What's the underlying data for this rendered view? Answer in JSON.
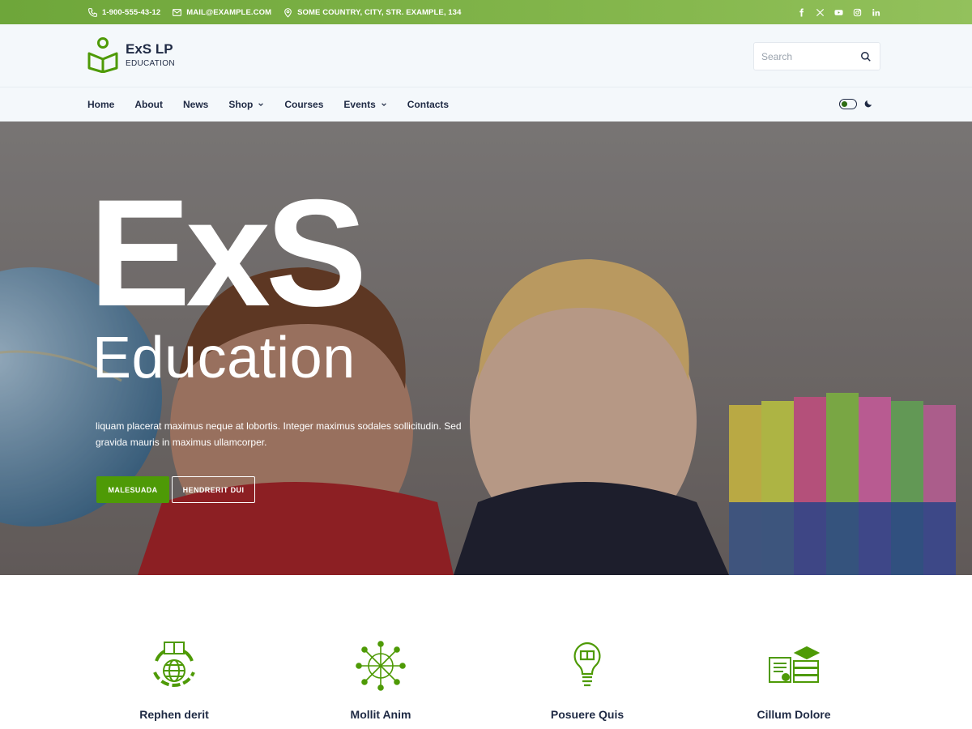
{
  "topbar": {
    "phone": "1-900-555-43-12",
    "email": "MAIL@EXAMPLE.COM",
    "address": "SOME COUNTRY, CITY, STR. EXAMPLE, 134",
    "social_icons": [
      "facebook-icon",
      "x-twitter-icon",
      "youtube-icon",
      "instagram-icon",
      "linkedin-icon"
    ],
    "accent": "#6ea63a"
  },
  "header": {
    "brand": "ExS LP",
    "tagline": "EDUCATION",
    "search_placeholder": "Search"
  },
  "nav": {
    "items": [
      {
        "label": "Home"
      },
      {
        "label": "About"
      },
      {
        "label": "News"
      },
      {
        "label": "Shop"
      },
      {
        "label": "Courses"
      },
      {
        "label": "Events"
      },
      {
        "label": "Contacts"
      }
    ]
  },
  "hero": {
    "title": "ExS",
    "subtitle": "Education",
    "text": "liquam placerat maximus neque at lobortis. Integer maximus sodales sollicitudin. Sed gravida mauris in maximus ullamcorper.",
    "primary_button": "MALESUADA",
    "secondary_button": "HENDRERIT DUI",
    "button_color": "#4e9a06"
  },
  "features": [
    {
      "label": "Rephen derit",
      "icon": "globe-book-icon"
    },
    {
      "label": "Mollit Anim",
      "icon": "network-icon"
    },
    {
      "label": "Posuere Quis",
      "icon": "lightbulb-book-icon"
    },
    {
      "label": "Cillum Dolore",
      "icon": "diploma-books-icon"
    }
  ],
  "colors": {
    "dark_text": "#1f2a44",
    "green": "#4e9a06",
    "header_bg": "#f4f8fb"
  }
}
